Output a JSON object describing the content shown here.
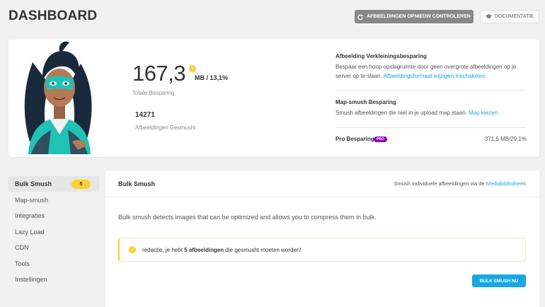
{
  "header": {
    "title": "DASHBOARD",
    "recheck_label": "AFBEELDINGEN OPNIEUW CONTROLEREN",
    "docs_label": "DOCUMENTATIE"
  },
  "summary": {
    "savings_value": "167,3",
    "savings_unit": "MB / 13,1%",
    "savings_label": "Totale Besparing",
    "count_value": "14271",
    "count_label": "Afbeeldingen Gesmusht",
    "resize": {
      "title": "Afbeelding Verkleiningsbesparing",
      "text_line1": "Bespaar een hoop opslagruimte door geen overgrote afbeeldingen op je",
      "text_line2": "server op te slaan.",
      "link": "Afbeeldingsformaat wijzigen inschakelen"
    },
    "dir_smush": {
      "title": "Map-smush Besparing",
      "text": "Smush afbeeldingen die niet in je upload map staan.",
      "link": "Map kiezen"
    },
    "pro": {
      "label": "Pro Besparing",
      "badge": "PRO",
      "value": "371,5 MB/29,1%"
    }
  },
  "nav": {
    "items": [
      {
        "label": "Bulk Smush",
        "badge": "5"
      },
      {
        "label": "Map-smush"
      },
      {
        "label": "Integraties"
      },
      {
        "label": "Lazy Load"
      },
      {
        "label": "CDN"
      },
      {
        "label": "Tools"
      },
      {
        "label": "Instellingen"
      }
    ]
  },
  "panel": {
    "title": "Bulk Smush",
    "aside_text": "Smush individuele afbeeldingen via de",
    "aside_link": "Mediabibliotheek",
    "description": "Bulk smush detects images that can be optimized and allows you to compress them in bulk.",
    "notice_pre": "redactie, je hebt",
    "notice_bold": "5 afbeeldingen",
    "notice_post": "die gesmusht moeten worden!",
    "button_label": "BULK SMUSH NU"
  },
  "colors": {
    "accent": "#17a8e3",
    "warning": "#fecf2f",
    "pro": "#8d00b1",
    "mascot_teal": "#1fc2b5"
  },
  "icons": {
    "recheck": "refresh-icon",
    "docs": "graduation-cap-icon",
    "info": "info-icon",
    "warning": "warning-icon"
  }
}
